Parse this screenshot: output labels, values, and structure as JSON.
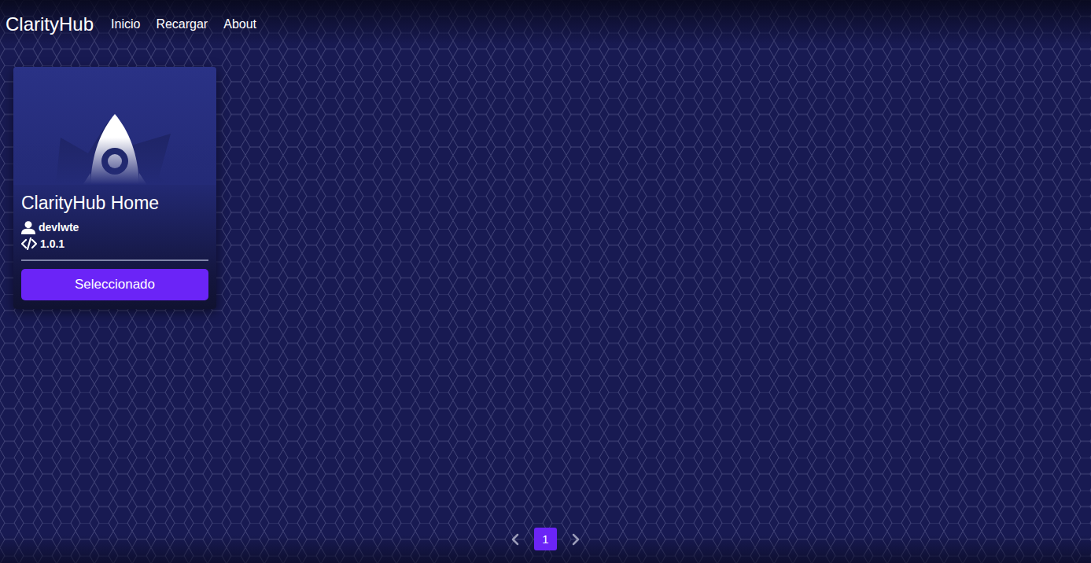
{
  "app": {
    "brand": "ClarityHub"
  },
  "nav": [
    {
      "label": "Inicio",
      "selected": false
    },
    {
      "label": "Recargar",
      "selected": false
    },
    {
      "label": "About",
      "selected": false
    }
  ],
  "cards": [
    {
      "title": "ClarityHub Home",
      "author": "devlwte",
      "version": "1.0.1",
      "button": "Seleccionado",
      "selected": true
    }
  ],
  "pagination": {
    "pages": [
      {
        "label": "1",
        "selected": true
      }
    ]
  }
}
